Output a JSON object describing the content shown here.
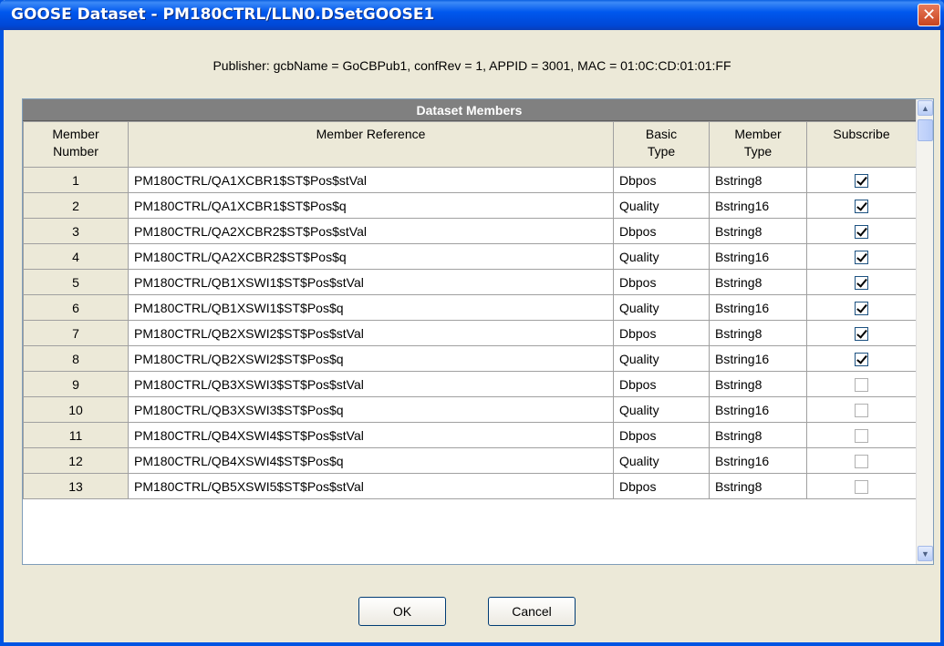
{
  "window": {
    "title": "GOOSE Dataset - PM180CTRL/LLN0.DSetGOOSE1",
    "close_glyph": "✕"
  },
  "publisher": "Publisher: gcbName = GoCBPub1, confRev = 1, APPID = 3001, MAC = 01:0C:CD:01:01:FF",
  "grid": {
    "band_title": "Dataset Members",
    "headers": {
      "number_line1": "Member",
      "number_line2": "Number",
      "reference": "Member Reference",
      "basic_line1": "Basic",
      "basic_line2": "Type",
      "member_type_line1": "Member",
      "member_type_line2": "Type",
      "subscribe": "Subscribe"
    },
    "rows": [
      {
        "n": "1",
        "ref": "PM180CTRL/QA1XCBR1$ST$Pos$stVal",
        "basic": "Dbpos",
        "mtype": "Bstring8",
        "sub": true
      },
      {
        "n": "2",
        "ref": "PM180CTRL/QA1XCBR1$ST$Pos$q",
        "basic": "Quality",
        "mtype": "Bstring16",
        "sub": true
      },
      {
        "n": "3",
        "ref": "PM180CTRL/QA2XCBR2$ST$Pos$stVal",
        "basic": "Dbpos",
        "mtype": "Bstring8",
        "sub": true
      },
      {
        "n": "4",
        "ref": "PM180CTRL/QA2XCBR2$ST$Pos$q",
        "basic": "Quality",
        "mtype": "Bstring16",
        "sub": true
      },
      {
        "n": "5",
        "ref": "PM180CTRL/QB1XSWI1$ST$Pos$stVal",
        "basic": "Dbpos",
        "mtype": "Bstring8",
        "sub": true
      },
      {
        "n": "6",
        "ref": "PM180CTRL/QB1XSWI1$ST$Pos$q",
        "basic": "Quality",
        "mtype": "Bstring16",
        "sub": true
      },
      {
        "n": "7",
        "ref": "PM180CTRL/QB2XSWI2$ST$Pos$stVal",
        "basic": "Dbpos",
        "mtype": "Bstring8",
        "sub": true
      },
      {
        "n": "8",
        "ref": "PM180CTRL/QB2XSWI2$ST$Pos$q",
        "basic": "Quality",
        "mtype": "Bstring16",
        "sub": true
      },
      {
        "n": "9",
        "ref": "PM180CTRL/QB3XSWI3$ST$Pos$stVal",
        "basic": "Dbpos",
        "mtype": "Bstring8",
        "sub": false
      },
      {
        "n": "10",
        "ref": "PM180CTRL/QB3XSWI3$ST$Pos$q",
        "basic": "Quality",
        "mtype": "Bstring16",
        "sub": false
      },
      {
        "n": "11",
        "ref": "PM180CTRL/QB4XSWI4$ST$Pos$stVal",
        "basic": "Dbpos",
        "mtype": "Bstring8",
        "sub": false
      },
      {
        "n": "12",
        "ref": "PM180CTRL/QB4XSWI4$ST$Pos$q",
        "basic": "Quality",
        "mtype": "Bstring16",
        "sub": false
      },
      {
        "n": "13",
        "ref": "PM180CTRL/QB5XSWI5$ST$Pos$stVal",
        "basic": "Dbpos",
        "mtype": "Bstring8",
        "sub": false
      }
    ]
  },
  "scrollbar": {
    "up_glyph": "▲",
    "down_glyph": "▼"
  },
  "buttons": {
    "ok": "OK",
    "cancel": "Cancel"
  },
  "colors": {
    "title_bar": "#0058ee",
    "dialog_bg": "#ece9d8",
    "band_bg": "#808080"
  }
}
